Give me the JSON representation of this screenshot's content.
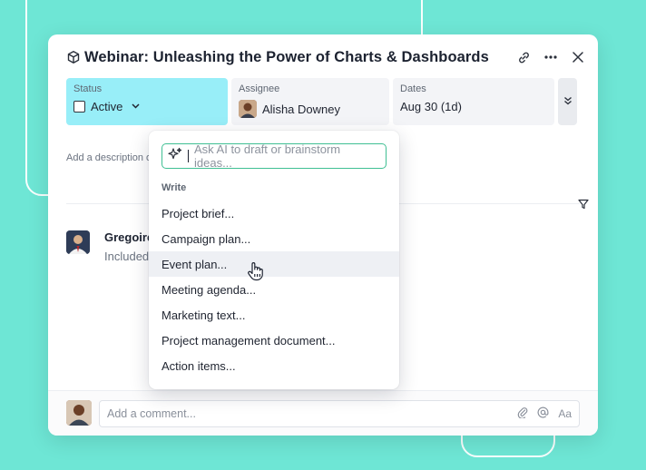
{
  "task": {
    "title": "Webinar: Unleashing the Power of Charts & Dashboards"
  },
  "fields": {
    "status_label": "Status",
    "status_value": "Active",
    "assignee_label": "Assignee",
    "assignee_value": "Alisha Downey",
    "dates_label": "Dates",
    "dates_value": "Aug 30 (1d)"
  },
  "description": {
    "placeholder": "Add a description o"
  },
  "activity": {
    "name": "Gregoire",
    "text": "Included"
  },
  "ai_menu": {
    "placeholder": "Ask AI to draft or brainstorm ideas...",
    "section": "Write",
    "items": [
      "Project brief...",
      "Campaign plan...",
      "Event plan...",
      "Meeting agenda...",
      "Marketing text...",
      "Project management document...",
      "Action items..."
    ],
    "hovered_index": 2
  },
  "comment": {
    "placeholder": "Add a comment...",
    "format_label": "Aa"
  },
  "colors": {
    "background": "#6ee6d5",
    "status_highlight": "#98eef8",
    "ai_input_border": "#3fbf93"
  }
}
